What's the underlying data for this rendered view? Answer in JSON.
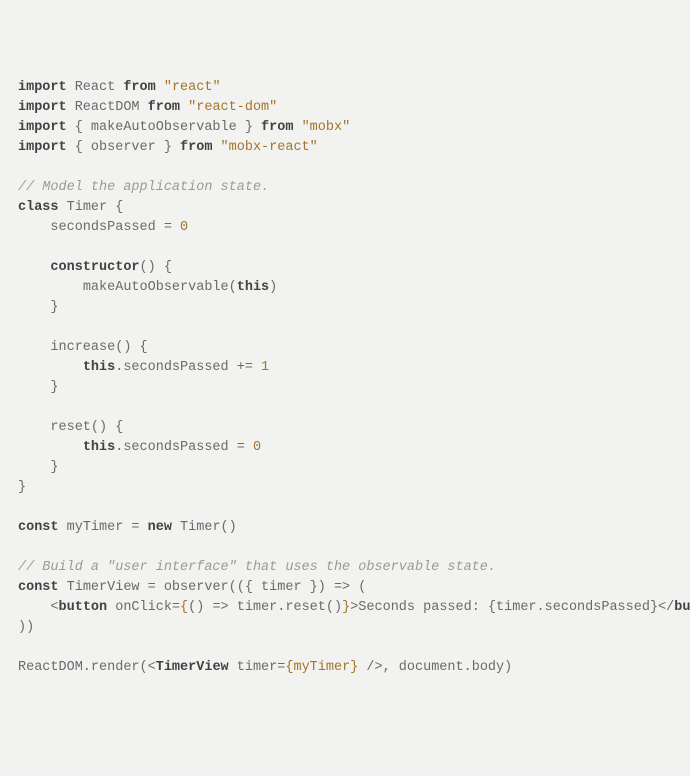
{
  "code": {
    "lines": [
      {
        "indent": 0,
        "segs": [
          [
            "kw",
            "import"
          ],
          [
            "",
            " React "
          ],
          [
            "kw",
            "from"
          ],
          [
            "",
            " "
          ],
          [
            "str",
            "\"react\""
          ]
        ]
      },
      {
        "indent": 0,
        "segs": [
          [
            "kw",
            "import"
          ],
          [
            "",
            " ReactDOM "
          ],
          [
            "kw",
            "from"
          ],
          [
            "",
            " "
          ],
          [
            "str",
            "\"react-dom\""
          ]
        ]
      },
      {
        "indent": 0,
        "segs": [
          [
            "kw",
            "import"
          ],
          [
            "",
            " { makeAutoObservable } "
          ],
          [
            "kw",
            "from"
          ],
          [
            "",
            " "
          ],
          [
            "str",
            "\"mobx\""
          ]
        ]
      },
      {
        "indent": 0,
        "segs": [
          [
            "kw",
            "import"
          ],
          [
            "",
            " { observer } "
          ],
          [
            "kw",
            "from"
          ],
          [
            "",
            " "
          ],
          [
            "str",
            "\"mobx-react\""
          ]
        ]
      },
      {
        "indent": 0,
        "segs": []
      },
      {
        "indent": 0,
        "segs": [
          [
            "com",
            "// Model the application state."
          ]
        ]
      },
      {
        "indent": 0,
        "segs": [
          [
            "kw",
            "class"
          ],
          [
            "",
            " Timer {"
          ]
        ]
      },
      {
        "indent": 1,
        "segs": [
          [
            "",
            "secondsPassed = "
          ],
          [
            "num",
            "0"
          ]
        ]
      },
      {
        "indent": 0,
        "segs": []
      },
      {
        "indent": 1,
        "segs": [
          [
            "kw",
            "constructor"
          ],
          [
            "",
            "() {"
          ]
        ]
      },
      {
        "indent": 2,
        "segs": [
          [
            "",
            "makeAutoObservable("
          ],
          [
            "kw",
            "this"
          ],
          [
            "",
            ")"
          ]
        ]
      },
      {
        "indent": 1,
        "segs": [
          [
            "",
            "}"
          ]
        ]
      },
      {
        "indent": 0,
        "segs": []
      },
      {
        "indent": 1,
        "segs": [
          [
            "",
            "increase() {"
          ]
        ]
      },
      {
        "indent": 2,
        "segs": [
          [
            "kw",
            "this"
          ],
          [
            "",
            ".secondsPassed += "
          ],
          [
            "num",
            "1"
          ]
        ]
      },
      {
        "indent": 1,
        "segs": [
          [
            "",
            "}"
          ]
        ]
      },
      {
        "indent": 0,
        "segs": []
      },
      {
        "indent": 1,
        "segs": [
          [
            "",
            "reset() {"
          ]
        ]
      },
      {
        "indent": 2,
        "segs": [
          [
            "kw",
            "this"
          ],
          [
            "",
            ".secondsPassed = "
          ],
          [
            "num",
            "0"
          ]
        ]
      },
      {
        "indent": 1,
        "segs": [
          [
            "",
            "}"
          ]
        ]
      },
      {
        "indent": 0,
        "segs": [
          [
            "",
            "}"
          ]
        ]
      },
      {
        "indent": 0,
        "segs": []
      },
      {
        "indent": 0,
        "segs": [
          [
            "kw",
            "const"
          ],
          [
            "",
            " myTimer = "
          ],
          [
            "kw",
            "new"
          ],
          [
            "",
            " Timer()"
          ]
        ]
      },
      {
        "indent": 0,
        "segs": []
      },
      {
        "indent": 0,
        "segs": [
          [
            "com",
            "// Build a \"user interface\" that uses the observable state."
          ]
        ]
      },
      {
        "indent": 0,
        "segs": [
          [
            "kw",
            "const"
          ],
          [
            "",
            " TimerView = observer(({ timer }) => ("
          ]
        ]
      },
      {
        "indent": 1,
        "segs": [
          [
            "",
            "<"
          ],
          [
            "kw",
            "button"
          ],
          [
            "",
            " onClick="
          ],
          [
            "num",
            "{"
          ],
          [
            "",
            "() => timer.reset()"
          ],
          [
            "num",
            "}"
          ],
          [
            "",
            ">Seconds passed: {timer.secondsPassed}</"
          ],
          [
            "kw",
            "button"
          ],
          [
            "",
            ">"
          ]
        ]
      },
      {
        "indent": 0,
        "segs": [
          [
            "",
            "))"
          ]
        ]
      },
      {
        "indent": 0,
        "segs": []
      },
      {
        "indent": 0,
        "segs": [
          [
            "",
            "ReactDOM.render(<"
          ],
          [
            "kw",
            "TimerView"
          ],
          [
            "",
            " timer="
          ],
          [
            "num",
            "{myTimer}"
          ],
          [
            "",
            " />, document.body)"
          ]
        ]
      }
    ],
    "indentUnit": "    "
  }
}
